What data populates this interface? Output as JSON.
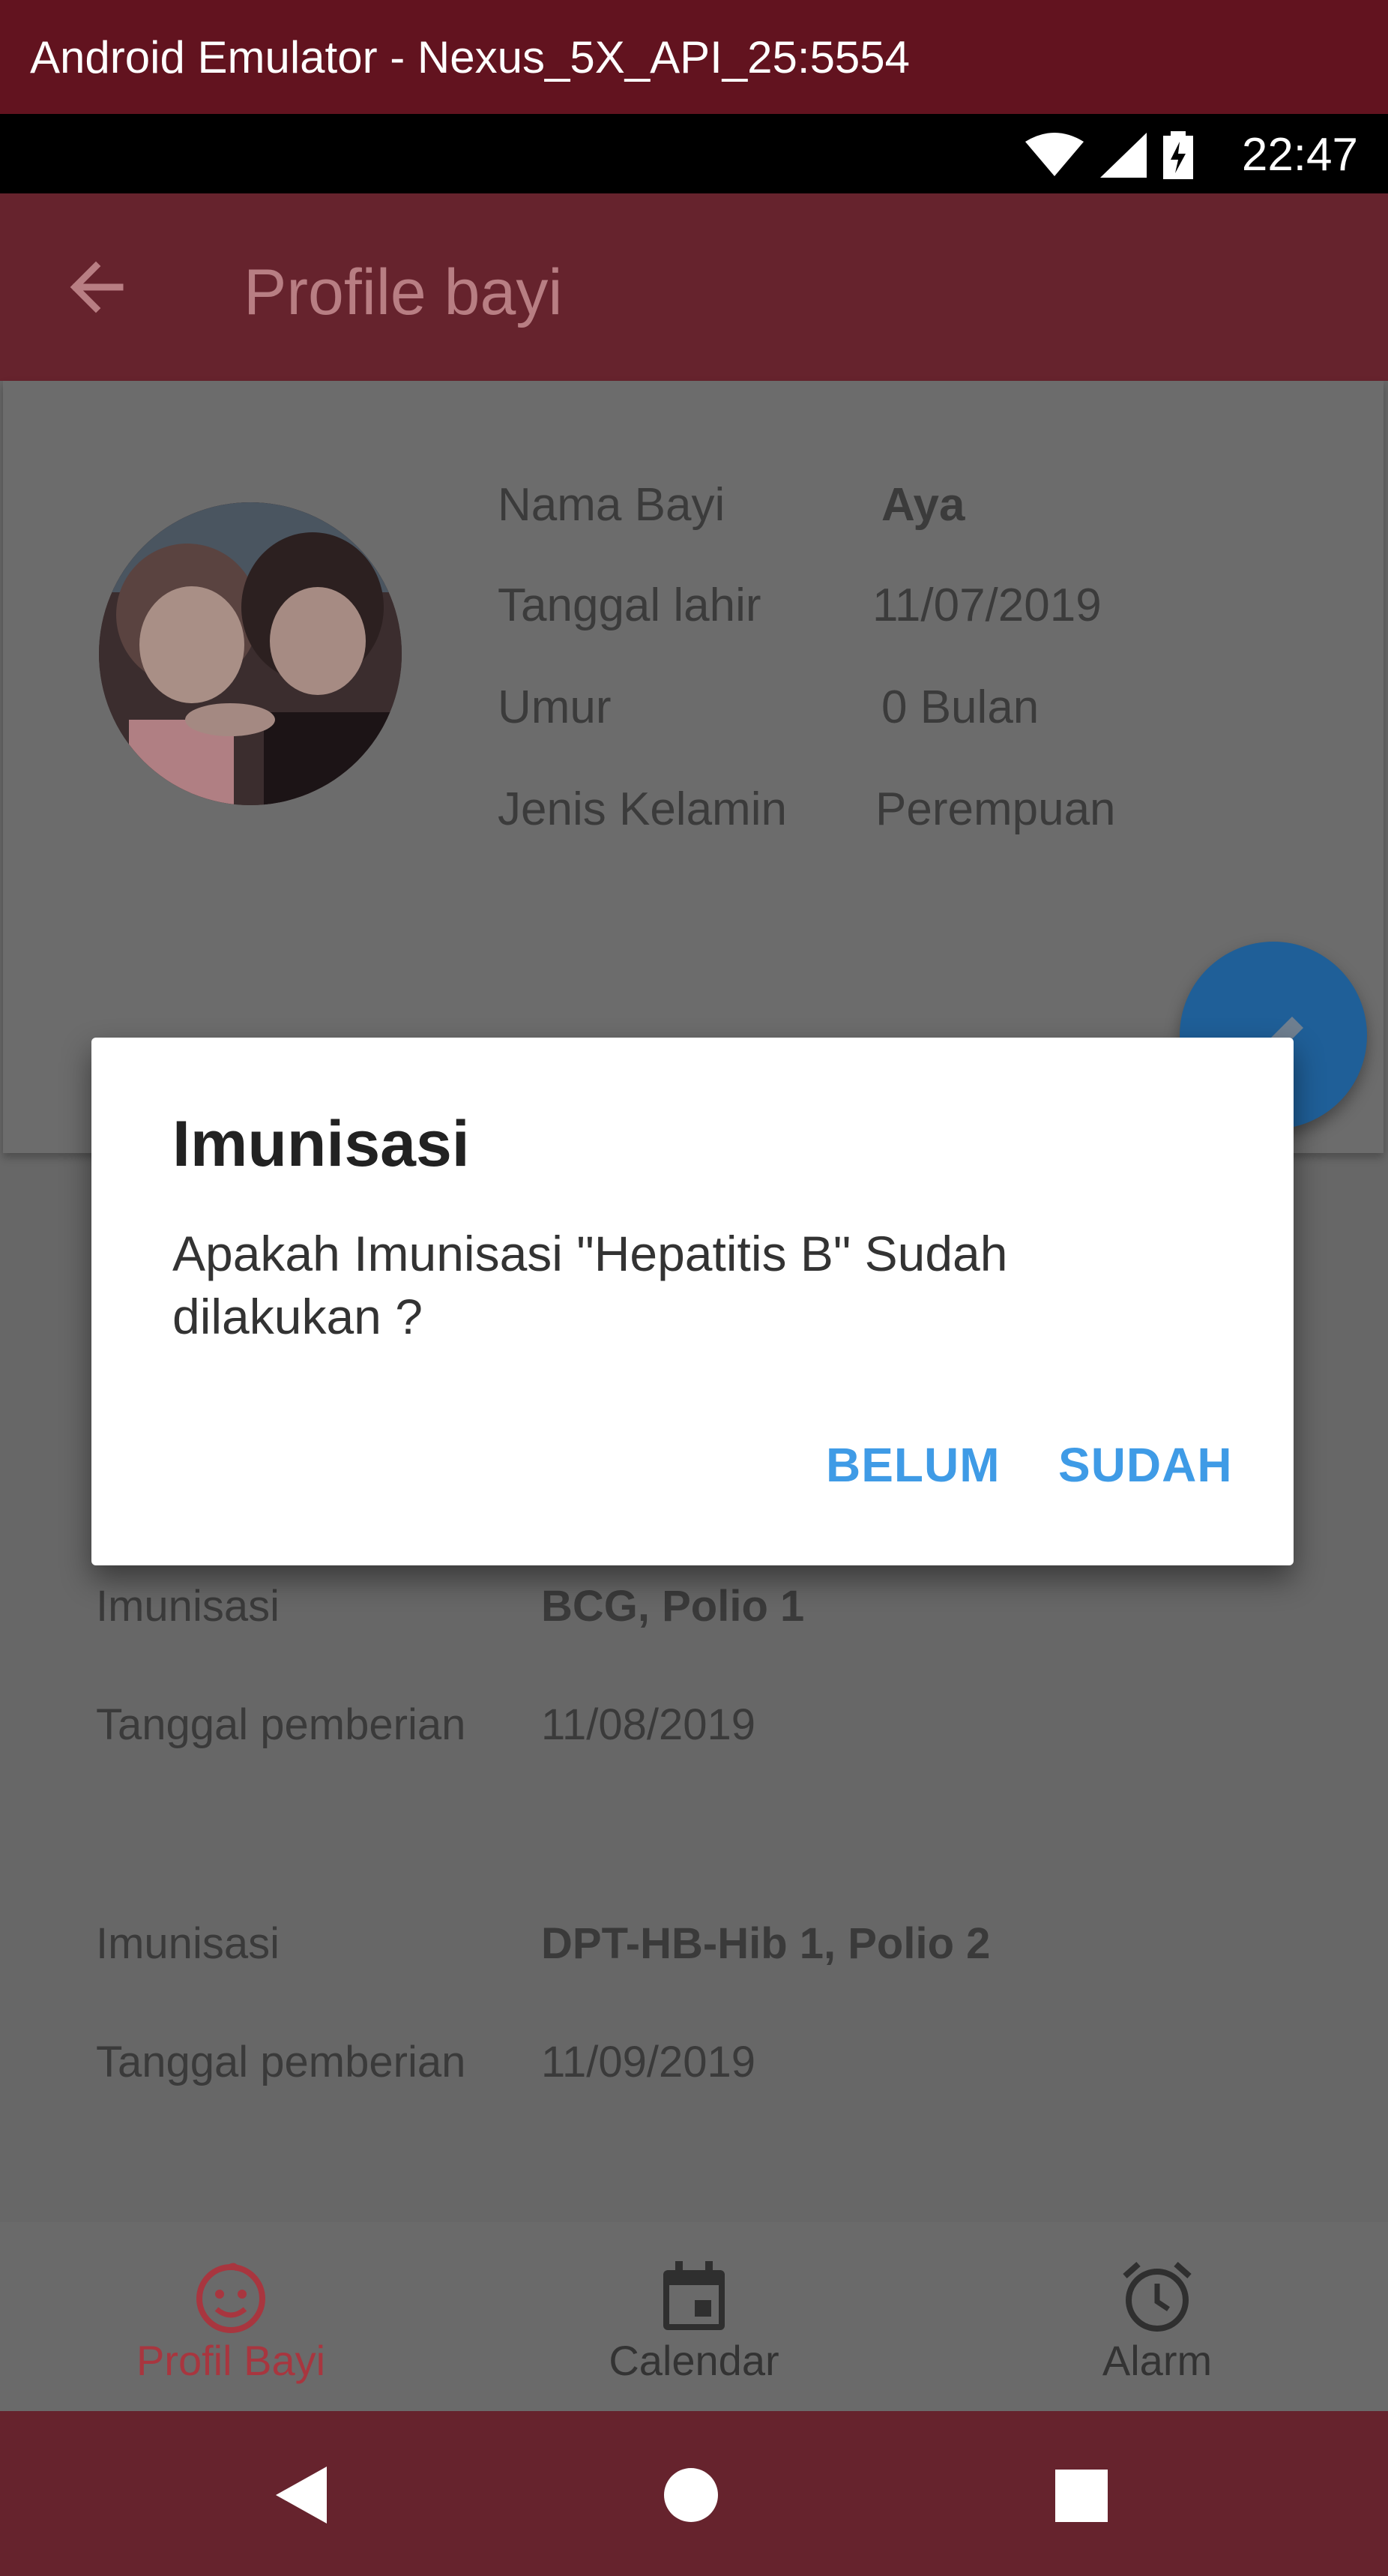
{
  "window": {
    "title": "Android Emulator - Nexus_5X_API_25:5554"
  },
  "status_bar": {
    "time": "22:47",
    "icons": [
      "wifi-icon",
      "cell-signal-icon",
      "battery-charging-icon"
    ]
  },
  "app_bar": {
    "title": "Profile bayi",
    "back_icon": "arrow-back-icon"
  },
  "profile": {
    "rows": [
      {
        "label": "Nama Bayi",
        "value": "Aya"
      },
      {
        "label": "Tanggal lahir",
        "value": "11/07/2019"
      },
      {
        "label": "Umur",
        "value": "0 Bulan"
      },
      {
        "label": "Jenis Kelamin",
        "value": "Perempuan"
      }
    ]
  },
  "schedule": [
    {
      "imunisasi_label": "Imunisasi",
      "imunisasi_value": "BCG, Polio 1",
      "tanggal_label": "Tanggal pemberian",
      "tanggal_value": "11/08/2019"
    },
    {
      "imunisasi_label": "Imunisasi",
      "imunisasi_value": "DPT-HB-Hib 1, Polio 2",
      "tanggal_label": "Tanggal pemberian",
      "tanggal_value": "11/09/2019"
    }
  ],
  "dialog": {
    "title": "Imunisasi",
    "message": "Apakah Imunisasi \"Hepatitis B\" Sudah dilakukan ?",
    "negative": "BELUM",
    "positive": "SUDAH"
  },
  "bottom_nav": {
    "items": [
      {
        "label": "Profil Bayi",
        "icon": "baby-face-icon",
        "active": true
      },
      {
        "label": "Calendar",
        "icon": "calendar-icon",
        "active": false
      },
      {
        "label": "Alarm",
        "icon": "alarm-clock-icon",
        "active": false
      }
    ]
  },
  "colors": {
    "primary": "#66232d",
    "titlebar": "#62131f",
    "accent_blue": "#3f9be6",
    "active_nav": "#a8363f"
  }
}
